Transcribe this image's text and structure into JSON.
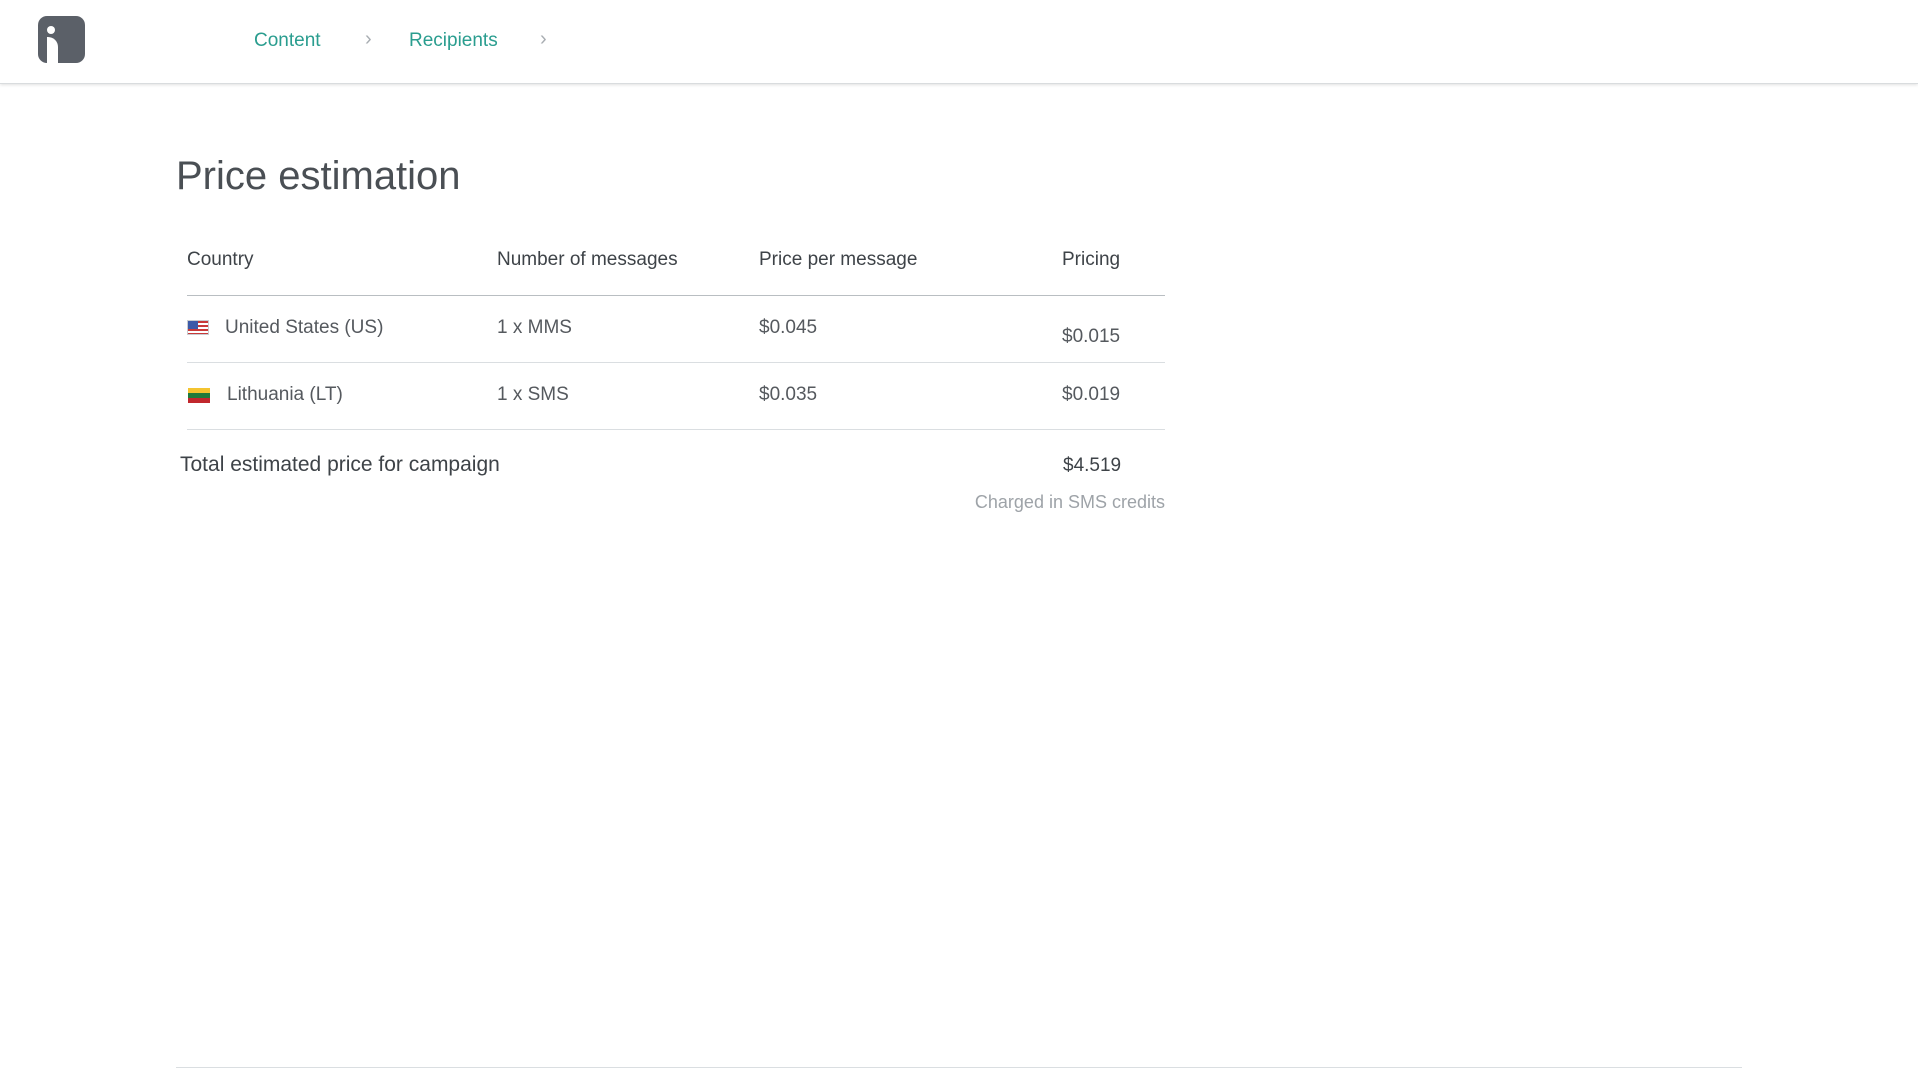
{
  "nav": {
    "logo_icon": "brand-logo-icon",
    "breadcrumbs": [
      {
        "label": "Content"
      },
      {
        "label": "Recipients"
      }
    ],
    "separator_icon": "chevron-right-icon",
    "accent_color": "#2a9d8f"
  },
  "page": {
    "title": "Price estimation"
  },
  "table": {
    "headers": [
      "Country",
      "Number of messages",
      "Price per message",
      "Pricing"
    ],
    "rows": [
      {
        "country": "United States (US)",
        "flag": "us-flag-icon",
        "messages": "1 x MMS",
        "price_per_message": "$0.045",
        "pricing": "$0.015"
      },
      {
        "country": "Lithuania (LT)",
        "flag": "lt-flag-icon",
        "messages": "1 x SMS",
        "price_per_message": "$0.035",
        "pricing": "$0.019"
      }
    ]
  },
  "total": {
    "label": "Total estimated price for campaign",
    "value": "$4.519",
    "note": "Charged in SMS credits"
  }
}
